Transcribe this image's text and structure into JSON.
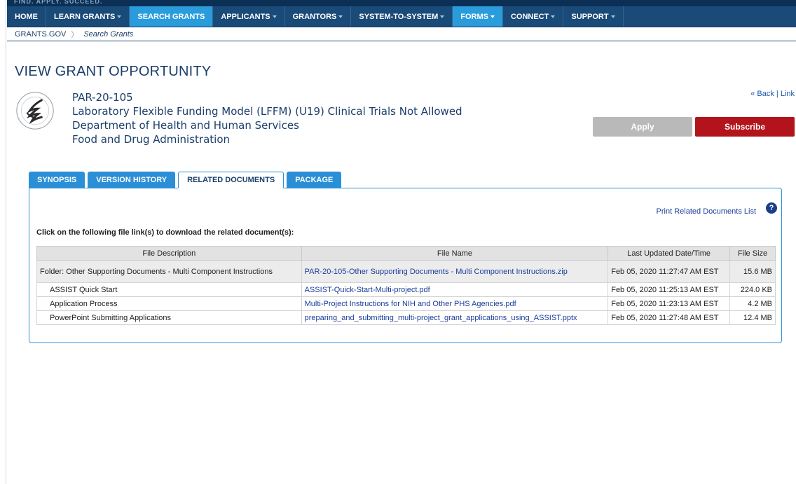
{
  "header": {
    "tagline": "FIND. APPLY. SUCCEED."
  },
  "nav": [
    {
      "label": "HOME",
      "caret": false,
      "state": "normal"
    },
    {
      "label": "LEARN GRANTS",
      "caret": true,
      "state": "normal"
    },
    {
      "label": "SEARCH GRANTS",
      "caret": false,
      "state": "active"
    },
    {
      "label": "APPLICANTS",
      "caret": true,
      "state": "normal"
    },
    {
      "label": "GRANTORS",
      "caret": true,
      "state": "normal"
    },
    {
      "label": "SYSTEM-TO-SYSTEM",
      "caret": true,
      "state": "normal"
    },
    {
      "label": "FORMS",
      "caret": true,
      "state": "highlight"
    },
    {
      "label": "CONNECT",
      "caret": true,
      "state": "normal"
    },
    {
      "label": "SUPPORT",
      "caret": true,
      "state": "normal"
    }
  ],
  "breadcrumb": {
    "root": "GRANTS.GOV",
    "separator": "〉",
    "current": "Search Grants"
  },
  "page": {
    "title": "VIEW GRANT OPPORTUNITY"
  },
  "opportunity": {
    "number": "PAR-20-105",
    "title": "Laboratory Flexible Funding Model (LFFM) (U19) Clinical Trials Not Allowed",
    "agency": "Department of Health and Human Services",
    "subagency": "Food and Drug Administration"
  },
  "links": {
    "back": "« Back",
    "divider": " | ",
    "link": "Link"
  },
  "buttons": {
    "apply": "Apply",
    "subscribe": "Subscribe"
  },
  "tabs": [
    {
      "label": "SYNOPSIS",
      "active": false
    },
    {
      "label": "VERSION HISTORY",
      "active": false
    },
    {
      "label": "RELATED DOCUMENTS",
      "active": true
    },
    {
      "label": "PACKAGE",
      "active": false
    }
  ],
  "related": {
    "print_link": "Print Related Documents List",
    "help_glyph": "?",
    "instructions": "Click on the following file link(s) to download the related document(s):",
    "columns": [
      "File Description",
      "File Name",
      "Last Updated Date/Time",
      "File Size"
    ],
    "rows": [
      {
        "type": "folder",
        "description": "Folder: Other Supporting Documents - Multi Component Instructions",
        "file": "PAR-20-105-Other Supporting Documents - Multi Component Instructions.zip",
        "updated": "Feb 05, 2020 11:27:47 AM EST",
        "size": "15.6 MB"
      },
      {
        "type": "file",
        "description": "ASSIST Quick Start",
        "file": "ASSIST-Quick-Start-Multi-project.pdf",
        "updated": "Feb 05, 2020 11:25:13 AM EST",
        "size": "224.0 KB"
      },
      {
        "type": "file",
        "description": "Application Process",
        "file": "Multi-Project Instructions for NIH and Other PHS Agencies.pdf",
        "updated": "Feb 05, 2020 11:23:13 AM EST",
        "size": "4.2 MB"
      },
      {
        "type": "file",
        "description": "PowerPoint Submitting Applications",
        "file": "preparing_and_submitting_multi-project_grant_applications_using_ASSIST.pptx",
        "updated": "Feb 05, 2020 11:27:48 AM EST",
        "size": "12.4 MB"
      }
    ]
  },
  "colors": {
    "nav_bg": "#1a4a78",
    "nav_active": "#2a9cdc",
    "title_blue": "#1a3e6a",
    "link_blue": "#1a3e9a",
    "apply_gray": "#b9b9b9",
    "subscribe_red": "#b3141b"
  },
  "icons": {
    "seal": "hhs-seal-icon",
    "help": "help-icon",
    "caret": "caret-down-icon"
  }
}
